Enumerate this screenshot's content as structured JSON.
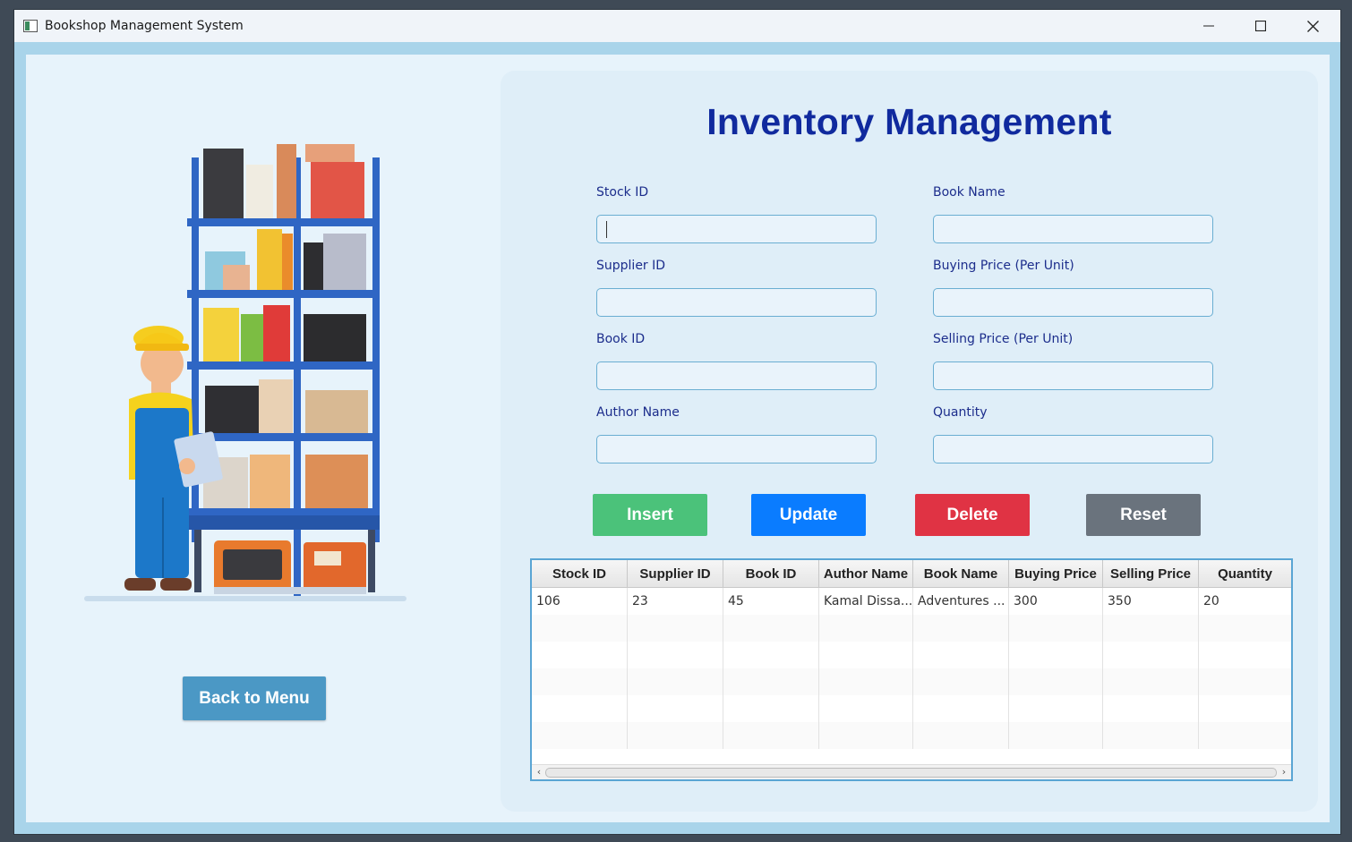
{
  "window": {
    "title": "Bookshop Management System"
  },
  "colors": {
    "accent": "#102a9e",
    "insert": "#4bc27a",
    "update": "#0a7cff",
    "delete": "#e03344",
    "reset": "#6a737d",
    "back": "#4b98c5"
  },
  "icons": {
    "app": "window-app-icon",
    "minimize": "minimize-icon",
    "maximize": "maximize-icon",
    "close": "close-icon"
  },
  "left": {
    "back_label": "Back to Menu"
  },
  "form": {
    "heading": "Inventory Management",
    "fields": {
      "stock_id": {
        "label": "Stock ID",
        "value": ""
      },
      "book_name": {
        "label": "Book Name",
        "value": ""
      },
      "supplier_id": {
        "label": "Supplier ID",
        "value": ""
      },
      "buying_price": {
        "label": "Buying Price (Per Unit)",
        "value": ""
      },
      "book_id": {
        "label": "Book ID",
        "value": ""
      },
      "selling_price": {
        "label": "Selling Price (Per Unit)",
        "value": ""
      },
      "author_name": {
        "label": "Author Name",
        "value": ""
      },
      "quantity": {
        "label": "Quantity",
        "value": ""
      }
    },
    "buttons": {
      "insert": "Insert",
      "update": "Update",
      "delete": "Delete",
      "reset": "Reset"
    }
  },
  "table": {
    "columns": [
      "Stock ID",
      "Supplier ID",
      "Book ID",
      "Author Name",
      "Book Name",
      "Buying Price",
      "Selling Price",
      "Quantity"
    ],
    "rows": [
      [
        "106",
        "23",
        "45",
        "Kamal Dissa...",
        "Adventures ...",
        "300",
        "350",
        "20"
      ]
    ]
  }
}
